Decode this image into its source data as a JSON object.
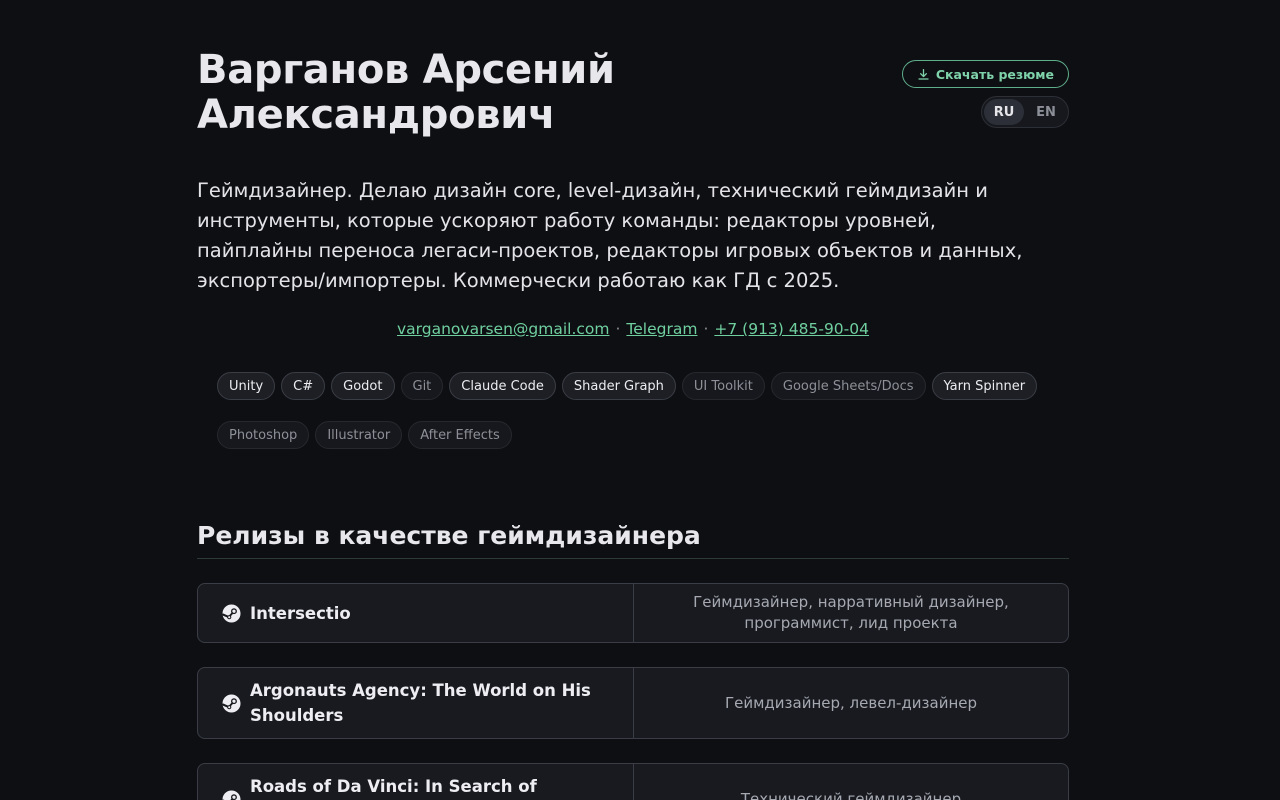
{
  "header": {
    "name_line1": "Варганов Арсений",
    "name_line2": "Александрович",
    "download_label": "Скачать резюме",
    "languages": [
      "RU",
      "EN"
    ],
    "active_language": "RU"
  },
  "bio": "Геймдизайнер. Делаю дизайн core, level-дизайн, технический геймдизайн и инструменты, которые ускоряют работу команды: редакторы уровней, пайплайны переноса легаси-проектов, редакторы игровых объектов и данных, экспортеры/импортеры. Коммерчески работаю как ГД с 2025.",
  "contacts": {
    "email": "varganovarsen@gmail.com",
    "telegram": "Telegram",
    "phone": "+7 (913) 485-90-04",
    "separator": "·"
  },
  "skills": [
    {
      "label": "Unity",
      "style": "strong"
    },
    {
      "label": "C#",
      "style": "strong"
    },
    {
      "label": "Godot",
      "style": "strong"
    },
    {
      "label": "Git",
      "style": "dim"
    },
    {
      "label": "Claude Code",
      "style": "strong"
    },
    {
      "label": "Shader Graph",
      "style": "strong"
    },
    {
      "label": "UI Toolkit",
      "style": "dim"
    },
    {
      "label": "Google Sheets/Docs",
      "style": "dim"
    },
    {
      "label": "Yarn Spinner",
      "style": "strong"
    },
    {
      "label": "Photoshop",
      "style": "dim"
    },
    {
      "label": "Illustrator",
      "style": "dim"
    },
    {
      "label": "After Effects",
      "style": "dim"
    }
  ],
  "releases_section": {
    "title": "Релизы в качестве геймдизайнера",
    "items": [
      {
        "title": "Intersectio",
        "role": "Геймдизайнер, нарративный дизайнер, программист, лид проекта",
        "icon": "steam-icon"
      },
      {
        "title": "Argonauts Agency: The World on His Shoulders",
        "role": "Геймдизайнер, левел-дизайнер",
        "icon": "steam-icon"
      },
      {
        "title": "Roads of Da Vinci: In Search of Origins",
        "role": "Технический геймдизайнер",
        "icon": "steam-icon"
      }
    ]
  },
  "colors": {
    "background": "#0e0f13",
    "accent": "#6fcf9f"
  }
}
